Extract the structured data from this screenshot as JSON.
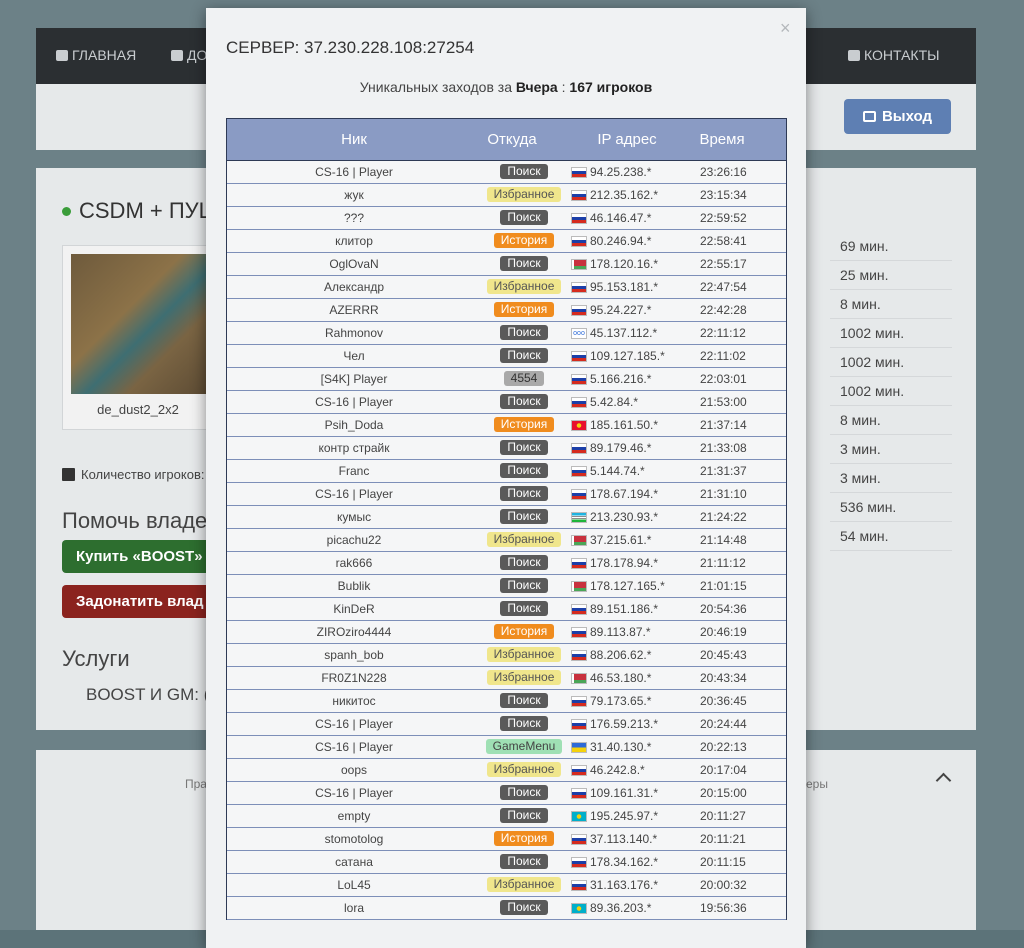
{
  "background": {
    "nav": [
      {
        "label": "ГЛАВНАЯ",
        "icon": "home-icon"
      },
      {
        "label": "ДО",
        "icon": "plus-square-icon"
      },
      {
        "label": "КОНТАКТЫ",
        "icon": "envelope-icon"
      }
    ],
    "logout_label": "Выход",
    "server_title": "CSDM + ПУШ",
    "map_name": "de_dust2_2x2",
    "stats": [
      "69 мин.",
      "25 мин.",
      "8 мин.",
      "1002 мин.",
      "1002 мин.",
      "1002 мин.",
      "8 мин.",
      "3 мин.",
      "3 мин.",
      "536 мин.",
      "54 мин."
    ],
    "players_label": "Количество игроков:",
    "help_heading": "Помочь владел",
    "boost_button": "Купить «BOOST»",
    "donate_button": "Задонатить влад",
    "services_heading": "Услуги",
    "services_item": "BOOST И GM:   (",
    "footer_left": "Пра",
    "footer_right": "еры"
  },
  "modal": {
    "close_symbol": "×",
    "title": "СЕРВЕР: 37.230.228.108:27254",
    "unique_prefix": "Уникальных заходов за",
    "unique_day": "Вчера",
    "unique_sep": ":",
    "unique_count": "167 игроков",
    "columns": {
      "nick": "Ник",
      "source": "Откуда",
      "ip": "IP адрес",
      "time": "Время"
    }
  },
  "source_styles": {
    "Поиск": {
      "bg": "#5a5a5a",
      "fg": "#ffffff"
    },
    "Избранное": {
      "bg": "#f0e68c",
      "fg": "#555555"
    },
    "История": {
      "bg": "#f08c1e",
      "fg": "#ffffff"
    },
    "4554": {
      "bg": "#a9a9a9",
      "fg": "#333333"
    },
    "GameMenu": {
      "bg": "#9fe0b4",
      "fg": "#444444"
    }
  },
  "rows": [
    {
      "nick": "CS-16 | Player",
      "source": "Поиск",
      "flag": "ru",
      "ip": "94.25.238.*",
      "time": "23:26:16"
    },
    {
      "nick": "жук",
      "source": "Избранное",
      "flag": "ru",
      "ip": "212.35.162.*",
      "time": "23:15:34"
    },
    {
      "nick": "???",
      "source": "Поиск",
      "flag": "ru",
      "ip": "46.146.47.*",
      "time": "22:59:52"
    },
    {
      "nick": "клитор",
      "source": "История",
      "flag": "ru",
      "ip": "80.246.94.*",
      "time": "22:58:41"
    },
    {
      "nick": "OglOvaN",
      "source": "Поиск",
      "flag": "by",
      "ip": "178.120.16.*",
      "time": "22:55:17"
    },
    {
      "nick": "Александр",
      "source": "Избранное",
      "flag": "ru",
      "ip": "95.153.181.*",
      "time": "22:47:54"
    },
    {
      "nick": "AZERRR",
      "source": "История",
      "flag": "ru",
      "ip": "95.24.227.*",
      "time": "22:42:28"
    },
    {
      "nick": "Rahmonov",
      "source": "Поиск",
      "flag": "olympic",
      "ip": "45.137.112.*",
      "time": "22:11:12"
    },
    {
      "nick": "Чел",
      "source": "Поиск",
      "flag": "ru",
      "ip": "109.127.185.*",
      "time": "22:11:02"
    },
    {
      "nick": "[S4K] Player",
      "source": "4554",
      "flag": "ru",
      "ip": "5.166.216.*",
      "time": "22:03:01"
    },
    {
      "nick": "CS-16 | Player",
      "source": "Поиск",
      "flag": "ru",
      "ip": "5.42.84.*",
      "time": "21:53:00"
    },
    {
      "nick": "Psih_Doda",
      "source": "История",
      "flag": "kg",
      "ip": "185.161.50.*",
      "time": "21:37:14"
    },
    {
      "nick": "контр страйк",
      "source": "Поиск",
      "flag": "ru",
      "ip": "89.179.46.*",
      "time": "21:33:08"
    },
    {
      "nick": "Franc",
      "source": "Поиск",
      "flag": "ru",
      "ip": "5.144.74.*",
      "time": "21:31:37"
    },
    {
      "nick": "CS-16 | Player",
      "source": "Поиск",
      "flag": "ru",
      "ip": "178.67.194.*",
      "time": "21:31:10"
    },
    {
      "nick": "кумыс",
      "source": "Поиск",
      "flag": "uz",
      "ip": "213.230.93.*",
      "time": "21:24:22"
    },
    {
      "nick": "picachu22",
      "source": "Избранное",
      "flag": "by",
      "ip": "37.215.61.*",
      "time": "21:14:48"
    },
    {
      "nick": "rak666",
      "source": "Поиск",
      "flag": "ru",
      "ip": "178.178.94.*",
      "time": "21:11:12"
    },
    {
      "nick": "Bublik",
      "source": "Поиск",
      "flag": "by",
      "ip": "178.127.165.*",
      "time": "21:01:15"
    },
    {
      "nick": "KinDeR",
      "source": "Поиск",
      "flag": "ru",
      "ip": "89.151.186.*",
      "time": "20:54:36"
    },
    {
      "nick": "ZIROziro4444",
      "source": "История",
      "flag": "ru",
      "ip": "89.113.87.*",
      "time": "20:46:19"
    },
    {
      "nick": "spanh_bob",
      "source": "Избранное",
      "flag": "ru",
      "ip": "88.206.62.*",
      "time": "20:45:43"
    },
    {
      "nick": "FR0Z1N228",
      "source": "Избранное",
      "flag": "by",
      "ip": "46.53.180.*",
      "time": "20:43:34"
    },
    {
      "nick": "никитос",
      "source": "Поиск",
      "flag": "ru",
      "ip": "79.173.65.*",
      "time": "20:36:45"
    },
    {
      "nick": "CS-16 | Player",
      "source": "Поиск",
      "flag": "ru",
      "ip": "176.59.213.*",
      "time": "20:24:44"
    },
    {
      "nick": "CS-16 | Player",
      "source": "GameMenu",
      "flag": "ua",
      "ip": "31.40.130.*",
      "time": "20:22:13"
    },
    {
      "nick": "oops",
      "source": "Избранное",
      "flag": "ru",
      "ip": "46.242.8.*",
      "time": "20:17:04"
    },
    {
      "nick": "CS-16 | Player",
      "source": "Поиск",
      "flag": "ru",
      "ip": "109.161.31.*",
      "time": "20:15:00"
    },
    {
      "nick": "empty",
      "source": "Поиск",
      "flag": "kz",
      "ip": "195.245.97.*",
      "time": "20:11:27"
    },
    {
      "nick": "stomotolog",
      "source": "История",
      "flag": "ru",
      "ip": "37.113.140.*",
      "time": "20:11:21"
    },
    {
      "nick": "сатана",
      "source": "Поиск",
      "flag": "ru",
      "ip": "178.34.162.*",
      "time": "20:11:15"
    },
    {
      "nick": "LoL45",
      "source": "Избранное",
      "flag": "ru",
      "ip": "31.163.176.*",
      "time": "20:00:32"
    },
    {
      "nick": "lora",
      "source": "Поиск",
      "flag": "kz",
      "ip": "89.36.203.*",
      "time": "19:56:36"
    }
  ]
}
